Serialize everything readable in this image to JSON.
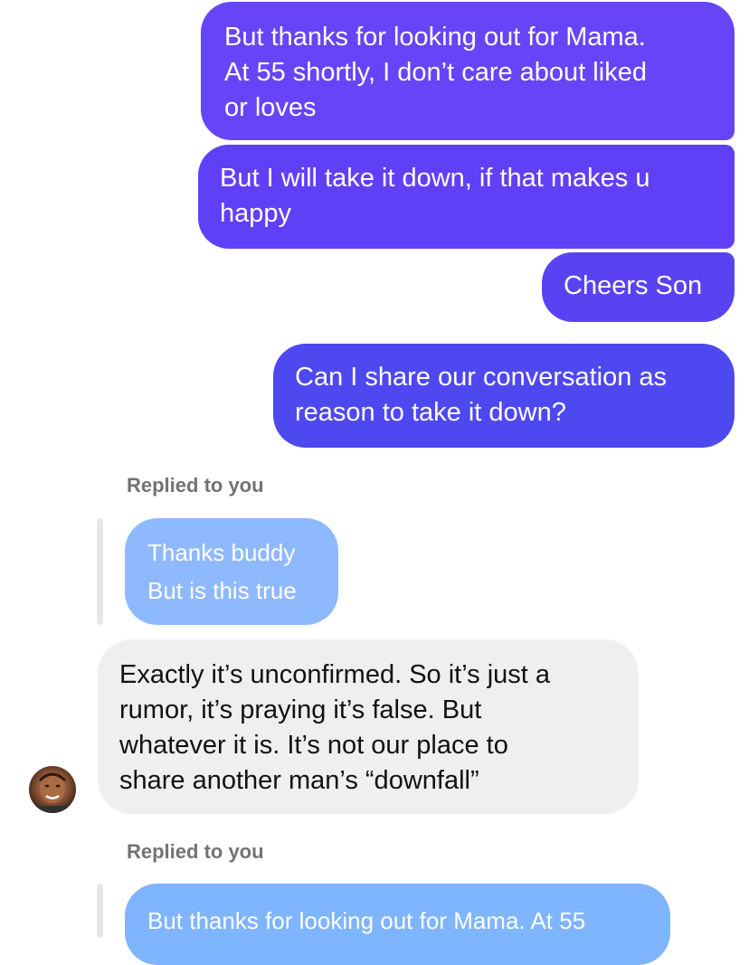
{
  "messages": {
    "sent_1": "But thanks for looking out for Mama.\nAt 55 shortly, I don’t care about liked\nor loves",
    "sent_2": "But I will take it down, if that makes u\nhappy",
    "sent_3": "Cheers Son",
    "sent_4": "Can I share our conversation as\nreason to take it down?",
    "reply_label_1": "Replied to you",
    "quoted_1": "Thanks buddy\nBut is this true",
    "received_1": "Exactly it’s unconfirmed. So it’s just a\nrumor, it’s praying it’s false. But\nwhatever it is. It’s not our place to\nshare another man’s “downfall”",
    "reply_label_2": "Replied to you",
    "quoted_2": "But thanks for looking out for Mama. At 55"
  },
  "colors": {
    "sent_gradient_top": "#6a45f7",
    "sent_gradient_bottom": "#5d3ff5",
    "sent_accent_blue": "#4f46f0",
    "received_bg": "#efefef",
    "quoted_bg": "#8fb9ff",
    "quoted_bg_2": "#7fb4ff",
    "label_gray": "#737373"
  },
  "icons": {
    "avatar": "contact-avatar"
  }
}
